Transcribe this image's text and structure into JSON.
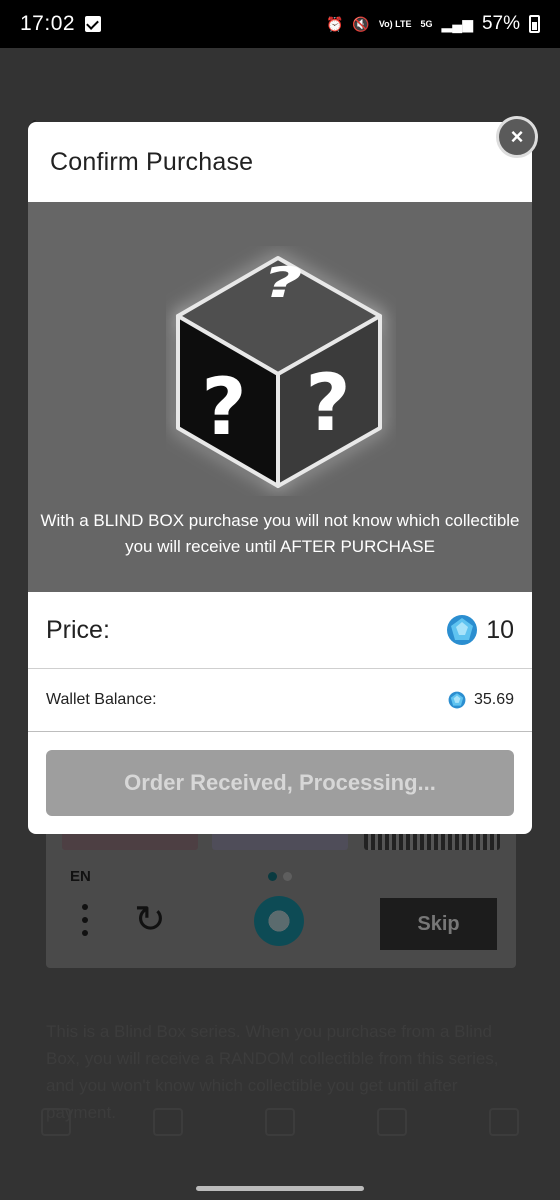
{
  "status_bar": {
    "time": "17:02",
    "signal_label": "Vo) LTE",
    "network": "5G",
    "battery": "57%"
  },
  "modal": {
    "title": "Confirm Purchase",
    "description": "With a BLIND BOX purchase you will not know which collectible you will receive until AFTER PURCHASE",
    "price_label": "Price:",
    "price_value": "10",
    "wallet_label": "Wallet Balance:",
    "wallet_value": "35.69",
    "order_button": "Order Received, Processing...",
    "close_glyph": "×"
  },
  "background": {
    "language": "EN",
    "skip_label": "Skip",
    "description": "This is a Blind Box series. When you purchase from a Blind Box, you will receive a RANDOM collectible from this series, and you won't know which collectible you get until after payment."
  },
  "icons": {
    "gem": "blue-gem-icon",
    "close": "close-icon",
    "mystery_box": "mystery-box-icon",
    "reload": "reload-icon",
    "menu": "kebab-menu-icon"
  },
  "colors": {
    "gem_blue": "#3a9bd8",
    "hero_bg": "#666666",
    "button_disabled": "#9e9e9e"
  }
}
